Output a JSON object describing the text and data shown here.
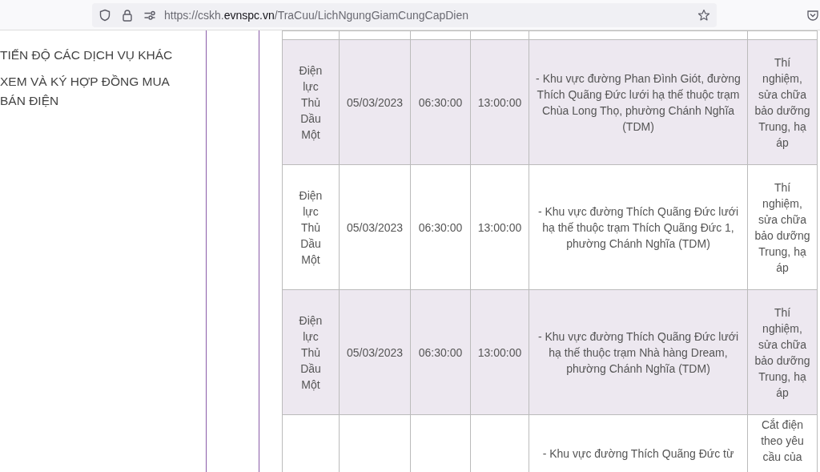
{
  "browser": {
    "url_parts": [
      "https://cskh.",
      "evnspc.vn",
      "/TraCuu/LichNgungGiamCungCapDien"
    ]
  },
  "sidebar": {
    "items": [
      "TIẾN ĐỘ CÁC DỊCH VỤ KHÁC",
      "XEM VÀ KÝ HỢP ĐỒNG MUA BÁN ĐIỆN"
    ]
  },
  "table": {
    "rows": [
      {
        "unit": "Điện lực Thủ Dầu Một",
        "date": "05/03/2023",
        "start": "06:30:00",
        "end": "13:00:00",
        "area": "- Khu vực đường Phan Đình Giót, đường Thích Quãng Đức lưới hạ thế thuộc trạm Chùa Long Thọ, phường Chánh Nghĩa (TDM)",
        "reason": "Thí nghiệm, sửa chữa bảo dưỡng Trung, hạ áp"
      },
      {
        "unit": "Điện lực Thủ Dầu Một",
        "date": "05/03/2023",
        "start": "06:30:00",
        "end": "13:00:00",
        "area": "- Khu vực đường Thích Quãng Đức lưới hạ thế thuộc trạm Thích Quãng Đức 1, phường Chánh Nghĩa (TDM)",
        "reason": "Thí nghiệm, sửa chữa bảo dưỡng Trung, hạ áp"
      },
      {
        "unit": "Điện lực Thủ Dầu Một",
        "date": "05/03/2023",
        "start": "06:30:00",
        "end": "13:00:00",
        "area": "- Khu vực đường Thích Quãng Đức lưới hạ thế thuộc trạm Nhà hàng Dream, phường Chánh Nghĩa (TDM)",
        "reason": "Thí nghiệm, sửa chữa bảo dưỡng Trung, hạ áp"
      },
      {
        "area": "- Khu vực đường Thích Quãng Đức từ",
        "reason": "Cắt điện theo yêu cầu của"
      }
    ]
  }
}
